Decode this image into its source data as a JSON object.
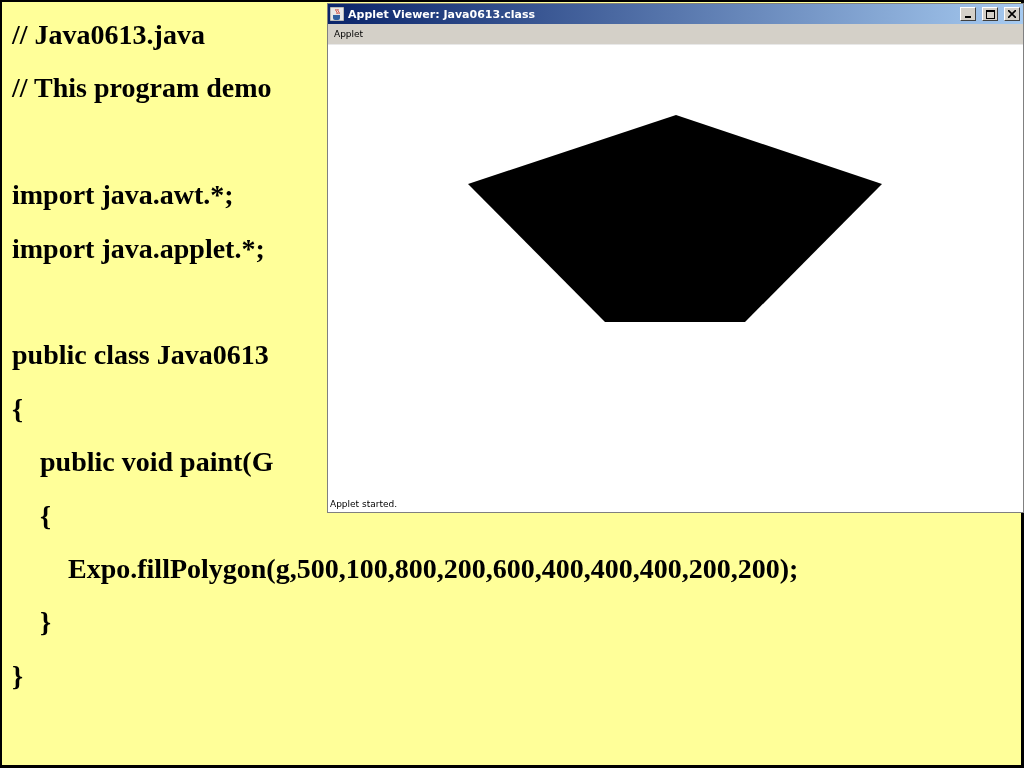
{
  "slide": {
    "code_lines": [
      {
        "kind": "code",
        "text": "// Java0613.java"
      },
      {
        "kind": "code",
        "text": "// This program demo"
      },
      {
        "kind": "blank"
      },
      {
        "kind": "code",
        "text": "import java.awt.*;"
      },
      {
        "kind": "code",
        "text": "import java.applet.*;"
      },
      {
        "kind": "blank"
      },
      {
        "kind": "code",
        "text": "public class Java0613"
      },
      {
        "kind": "code",
        "text": "{"
      },
      {
        "kind": "code",
        "text": "    public void paint(G"
      },
      {
        "kind": "code",
        "text": "    {"
      },
      {
        "kind": "code",
        "text": "        Expo.fillPolygon(g,500,100,800,200,600,400,400,400,200,200);"
      },
      {
        "kind": "code",
        "text": "    }"
      },
      {
        "kind": "code",
        "text": "}"
      }
    ]
  },
  "window": {
    "title": "Applet Viewer: Java0613.class",
    "menu": [
      "Applet"
    ],
    "status": "Applet started."
  }
}
